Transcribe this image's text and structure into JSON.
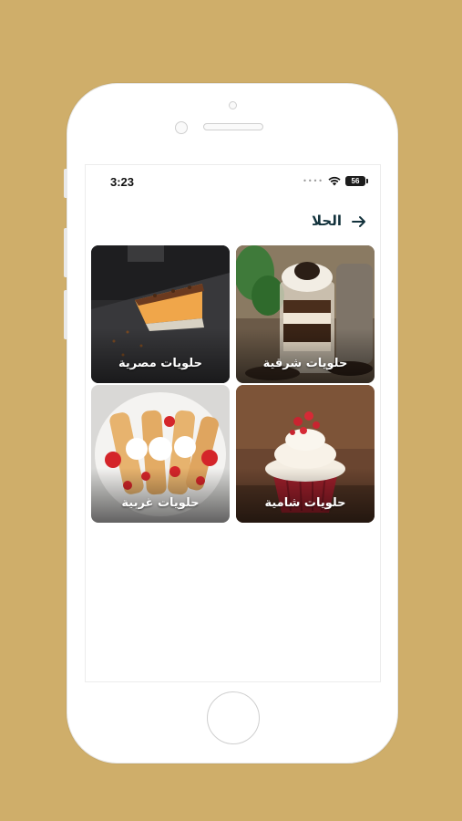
{
  "status_bar": {
    "time": "3:23",
    "signal_dots": "••••",
    "battery": "56"
  },
  "header": {
    "title": "الحلا",
    "back_icon": "arrow-right-icon"
  },
  "categories": [
    {
      "label": "حلويات شرقية"
    },
    {
      "label": "حلويات مصرية"
    },
    {
      "label": "حلويات شامية"
    },
    {
      "label": "حلويات غربية"
    }
  ],
  "colors": {
    "background": "#cfae6a",
    "title": "#13323c",
    "card_label": "#ffffff"
  }
}
